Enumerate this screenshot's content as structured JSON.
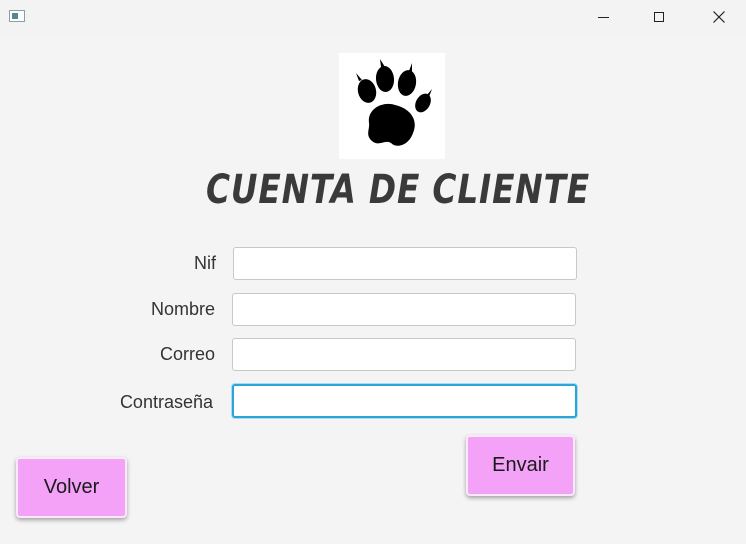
{
  "window": {
    "controls": [
      "minimize-icon",
      "maximize-icon",
      "close-icon"
    ]
  },
  "header": {
    "logo_icon": "paw-print-icon",
    "title": "CUENTA DE CLIENTE"
  },
  "form": {
    "fields": [
      {
        "label": "Nif",
        "value": "",
        "placeholder": ""
      },
      {
        "label": "Nombre",
        "value": "",
        "placeholder": ""
      },
      {
        "label": "Correo",
        "value": "",
        "placeholder": ""
      },
      {
        "label": "Contraseña",
        "value": "",
        "placeholder": "",
        "focused": true
      }
    ]
  },
  "buttons": {
    "submit_label": "Envair",
    "back_label": "Volver"
  },
  "colors": {
    "button_bg": "#f3a2f7",
    "focus_border": "#2aa6d6",
    "background": "#f4f4f4"
  }
}
